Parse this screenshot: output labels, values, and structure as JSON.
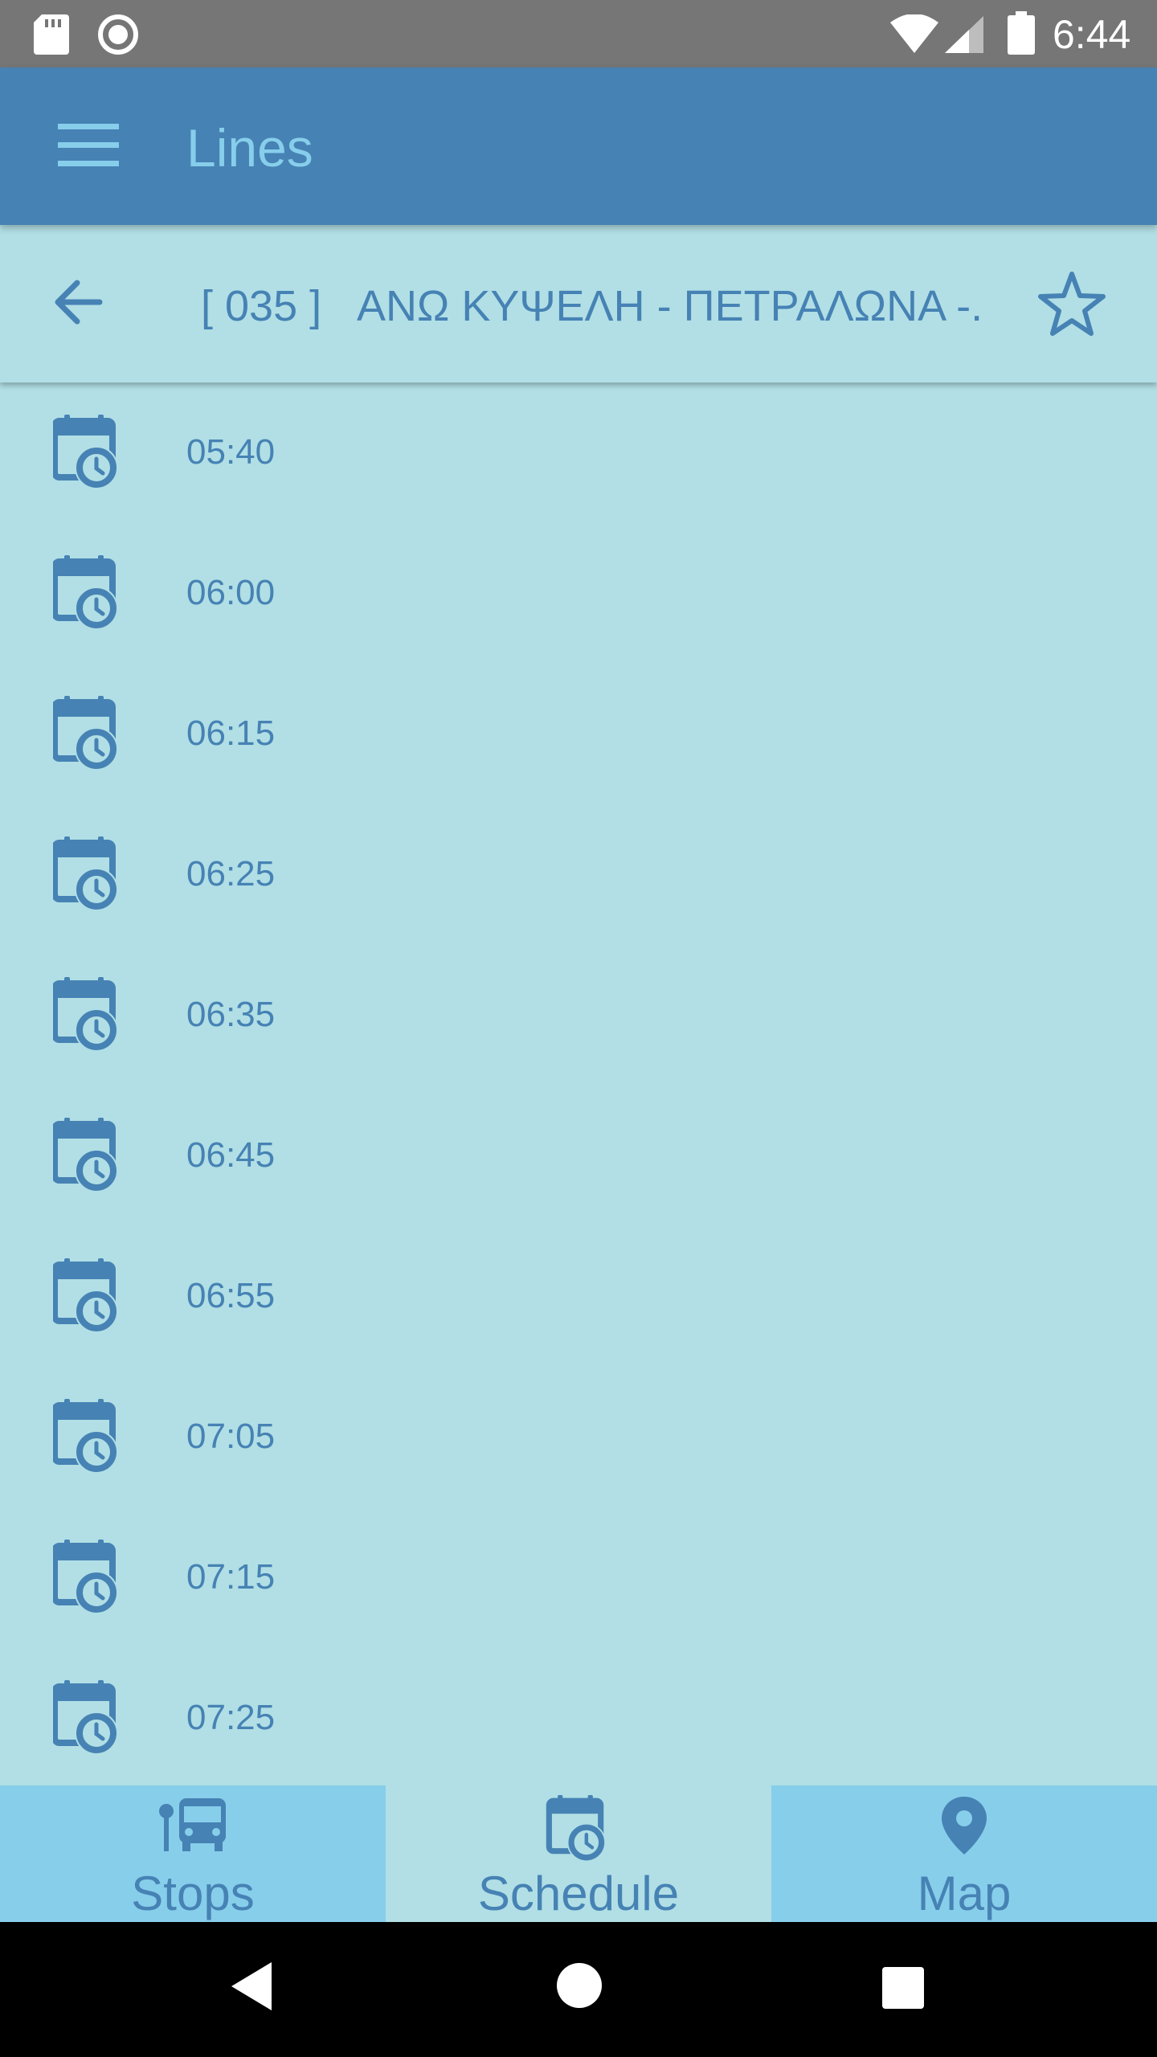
{
  "status_bar": {
    "time": "6:44"
  },
  "app_bar": {
    "title": "Lines",
    "menu_icon": "hamburger-menu-icon"
  },
  "line_header": {
    "code": "[ 035 ]",
    "name": "ΑΝΩ ΚΥΨΕΛΗ - ΠΕΤΡΑΛΩΝΑ -...",
    "back_icon": "arrow-left-icon",
    "favorite_icon": "star-outline-icon"
  },
  "schedule": {
    "item_icon": "calendar-clock-icon",
    "times": [
      "05:40",
      "06:00",
      "06:15",
      "06:25",
      "06:35",
      "06:45",
      "06:55",
      "07:05",
      "07:15",
      "07:25"
    ]
  },
  "bottom_nav": {
    "tabs": [
      {
        "label": "Stops",
        "icon": "bus-stop-icon",
        "active": false
      },
      {
        "label": "Schedule",
        "icon": "calendar-clock-icon",
        "active": true
      },
      {
        "label": "Map",
        "icon": "map-pin-icon",
        "active": false
      }
    ]
  },
  "colors": {
    "primary": "#4682b4",
    "light_accent": "#87ceeb",
    "background": "#b1dfe5",
    "status_bar": "#767676"
  }
}
